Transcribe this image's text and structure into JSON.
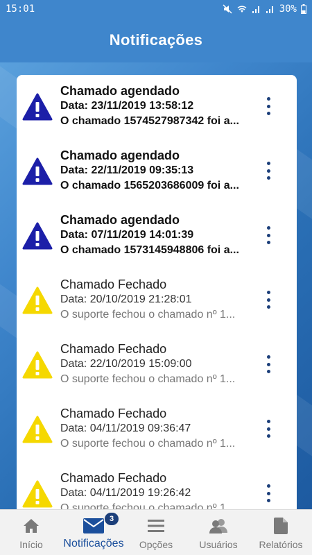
{
  "status_bar": {
    "time": "15:01",
    "battery": "30%"
  },
  "header": {
    "title": "Notificações"
  },
  "notifications": [
    {
      "title": "Chamado agendado",
      "date": "Data: 23/11/2019 13:58:12",
      "message": "O chamado 1574527987342 foi a...",
      "icon": "warning-blue",
      "unread": true
    },
    {
      "title": "Chamado agendado",
      "date": "Data: 22/11/2019 09:35:13",
      "message": "O chamado 1565203686009 foi a...",
      "icon": "warning-blue",
      "unread": true
    },
    {
      "title": "Chamado agendado",
      "date": "Data: 07/11/2019 14:01:39",
      "message": "O chamado 1573145948806 foi a...",
      "icon": "warning-blue",
      "unread": true
    },
    {
      "title": "Chamado Fechado",
      "date": "Data: 20/10/2019 21:28:01",
      "message": "O suporte fechou o chamado nº 1...",
      "icon": "warning-yellow",
      "unread": false
    },
    {
      "title": "Chamado Fechado",
      "date": "Data: 22/10/2019 15:09:00",
      "message": "O suporte fechou o chamado nº 1...",
      "icon": "warning-yellow",
      "unread": false
    },
    {
      "title": "Chamado Fechado",
      "date": "Data: 04/11/2019 09:36:47",
      "message": "O suporte fechou o chamado nº 1...",
      "icon": "warning-yellow",
      "unread": false
    },
    {
      "title": "Chamado Fechado",
      "date": "Data: 04/11/2019 19:26:42",
      "message": "O suporte fechou o chamado nº 1...",
      "icon": "warning-yellow",
      "unread": false
    }
  ],
  "bottom_nav": {
    "inicio": {
      "label": "Início",
      "icon": "home-icon"
    },
    "notificacoes": {
      "label": "Notificações",
      "icon": "mail-icon",
      "badge": "3",
      "active": true
    },
    "opcoes": {
      "label": "Opções",
      "icon": "menu-icon"
    },
    "usuarios": {
      "label": "Usuários",
      "icon": "users-icon"
    },
    "relatorios": {
      "label": "Relatórios",
      "icon": "document-icon"
    }
  },
  "colors": {
    "header": "#3f86cc",
    "warning_blue": "#1c1fa8",
    "warning_yellow": "#f5d800",
    "accent": "#1b4f9c"
  }
}
